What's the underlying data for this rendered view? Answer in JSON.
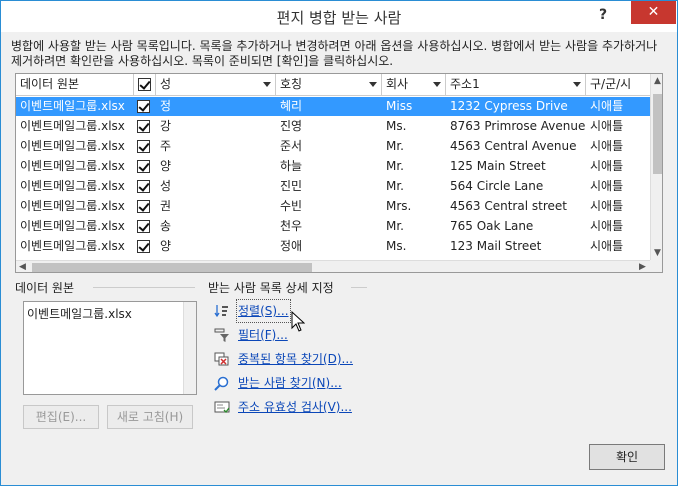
{
  "window": {
    "title": "편지 병합 받는 사람",
    "help": "?",
    "close": "✕"
  },
  "description": "병합에 사용할 받는 사람 목록입니다. 목록을 추가하거나 변경하려면 아래 옵션을 사용하십시오. 병합에서 받는 사람을 추가하거나 제거하려면 확인란을 사용하십시오. 목록이 준비되면 [확인]을 클릭하십시오.",
  "grid": {
    "columns": [
      "데이터 원본",
      "",
      "성",
      "호칭",
      "회사",
      "주소1",
      "구/군/시"
    ],
    "rows": [
      {
        "source": "이벤트메일그룹.xlsx",
        "checked": true,
        "last": "정",
        "first": "혜리",
        "title": "Miss",
        "address": "1232 Cypress Drive",
        "city": "시애틀",
        "selected": true
      },
      {
        "source": "이벤트메일그룹.xlsx",
        "checked": true,
        "last": "강",
        "first": "진영",
        "title": "Ms.",
        "address": "8763 Primrose Avenue",
        "city": "시애틀",
        "selected": false
      },
      {
        "source": "이벤트메일그룹.xlsx",
        "checked": true,
        "last": "주",
        "first": "준서",
        "title": "Mr.",
        "address": "4563 Central Avenue",
        "city": "시애틀",
        "selected": false
      },
      {
        "source": "이벤트메일그룹.xlsx",
        "checked": true,
        "last": "양",
        "first": "하늘",
        "title": "Mr.",
        "address": "125 Main Street",
        "city": "시애틀",
        "selected": false
      },
      {
        "source": "이벤트메일그룹.xlsx",
        "checked": true,
        "last": "성",
        "first": "진민",
        "title": "Mr.",
        "address": "564 Circle Lane",
        "city": "시애틀",
        "selected": false
      },
      {
        "source": "이벤트메일그룹.xlsx",
        "checked": true,
        "last": "권",
        "first": "수빈",
        "title": "Mrs.",
        "address": "4563 Central street",
        "city": "시애틀",
        "selected": false
      },
      {
        "source": "이벤트메일그룹.xlsx",
        "checked": true,
        "last": "송",
        "first": "천우",
        "title": "Mr.",
        "address": "765 Oak Lane",
        "city": "시애틀",
        "selected": false
      },
      {
        "source": "이벤트메일그룹.xlsx",
        "checked": true,
        "last": "양",
        "first": "정애",
        "title": "Ms.",
        "address": "123 Mail Street",
        "city": "시애틀",
        "selected": false
      }
    ]
  },
  "data_source": {
    "label": "데이터 원본",
    "items": [
      "이벤트메일그룹.xlsx"
    ],
    "edit_button": "편집(E)...",
    "refresh_button": "새로 고침(H)"
  },
  "refine": {
    "label": "받는 사람 목록 상세 지정",
    "links": [
      {
        "text": "정렬(S)...",
        "icon": "sort-icon"
      },
      {
        "text": "필터(F)...",
        "icon": "filter-icon"
      },
      {
        "text": "중복된 항목 찾기(D)...",
        "icon": "duplicates-icon"
      },
      {
        "text": "받는 사람 찾기(N)...",
        "icon": "find-recipient-icon"
      },
      {
        "text": "주소 유효성 검사(V)...",
        "icon": "validate-address-icon"
      }
    ]
  },
  "ok_button": "확인",
  "colors": {
    "selection": "#3399ff",
    "link": "#0b47b8",
    "close": "#c7372f",
    "border": "#2a8dd4"
  }
}
